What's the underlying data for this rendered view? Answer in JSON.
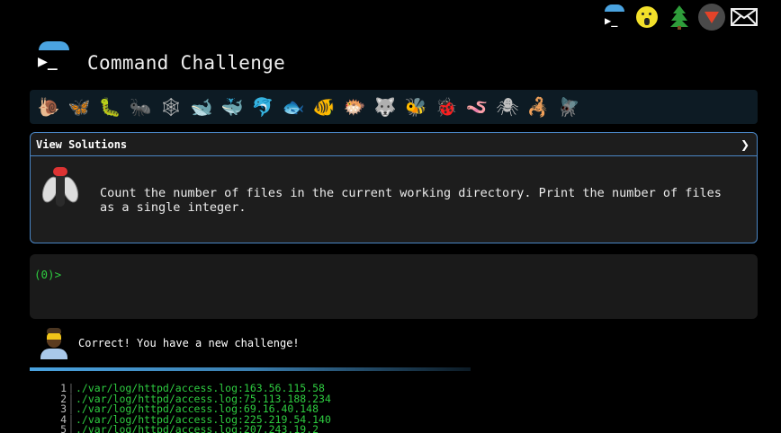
{
  "topbar": {
    "icons": [
      "command-challenge-logo-icon",
      "shushing-face-icon",
      "christmas-tree-icon",
      "gitlab-fox-icon",
      "mail-icon"
    ]
  },
  "header": {
    "title": "Command Challenge",
    "logo_glyph": "▶_"
  },
  "animals": [
    "snail",
    "butterfly",
    "caterpillar",
    "ant",
    "spider-web",
    "whale",
    "whale2",
    "dolphin",
    "fish",
    "tropical-fish",
    "blowfish",
    "wolf",
    "bee",
    "lady-beetle",
    "worm",
    "spider",
    "scorpion",
    "fly"
  ],
  "animal_glyphs": [
    "🐌",
    "🦋",
    "🐛",
    "🐜",
    "🕸",
    "🐋",
    "🐳",
    "🐬",
    "🐟",
    "🐠",
    "🐡",
    "🐺",
    "🐝",
    "🐞",
    "🪱",
    "🕷",
    "🦂",
    "🪰"
  ],
  "solutions": {
    "title": "View Solutions",
    "chevron": "❯",
    "challenge_text": "Count the number of files in the current working directory. Print the number of files as a single integer."
  },
  "terminal": {
    "prompt": "(0)>",
    "input_value": ""
  },
  "result": {
    "message": "Correct! You have a new challenge!"
  },
  "output": [
    {
      "n": "1",
      "text": "./var/log/httpd/access.log:163.56.115.58"
    },
    {
      "n": "2",
      "text": "./var/log/httpd/access.log:75.113.188.234"
    },
    {
      "n": "3",
      "text": "./var/log/httpd/access.log:69.16.40.148"
    },
    {
      "n": "4",
      "text": "./var/log/httpd/access.log:225.219.54.140"
    },
    {
      "n": "5",
      "text": "./var/log/httpd/access.log:207.243.19.2"
    }
  ],
  "colors": {
    "accent": "#4aa3e0",
    "prompt_green": "#2ecc40",
    "panel_border": "#4a86c5"
  }
}
